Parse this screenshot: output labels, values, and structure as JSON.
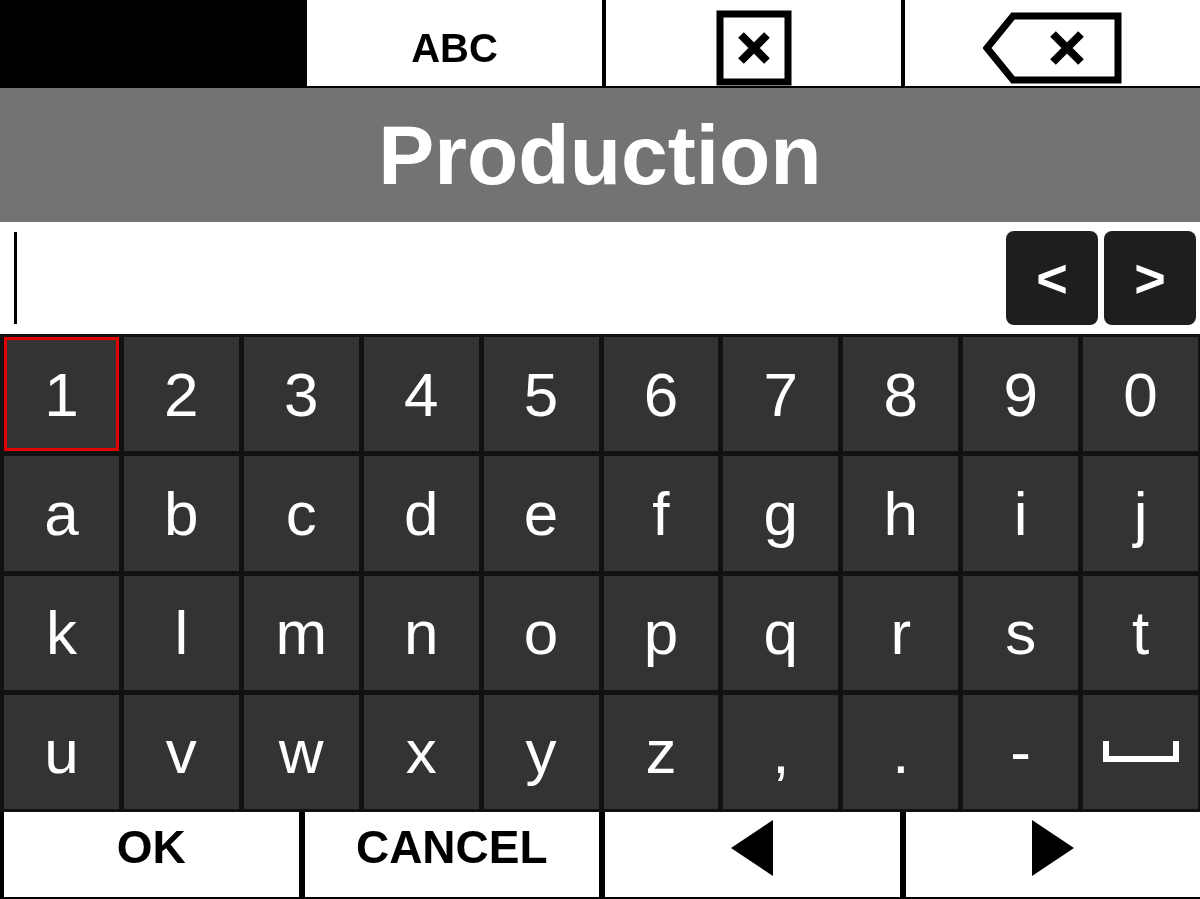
{
  "top_keys": [
    {
      "kind": "text",
      "label": "ABC"
    },
    {
      "kind": "clear"
    },
    {
      "kind": "backspace"
    }
  ],
  "title": "Production",
  "cursor_buttons": [
    "<",
    ">"
  ],
  "keyboard": [
    [
      {
        "kind": "char",
        "label": "1",
        "selected": true
      },
      {
        "kind": "char",
        "label": "2",
        "selected": false
      },
      {
        "kind": "char",
        "label": "3",
        "selected": false
      },
      {
        "kind": "char",
        "label": "4",
        "selected": false
      },
      {
        "kind": "char",
        "label": "5",
        "selected": false
      },
      {
        "kind": "char",
        "label": "6",
        "selected": false
      },
      {
        "kind": "char",
        "label": "7",
        "selected": false
      },
      {
        "kind": "char",
        "label": "8",
        "selected": false
      },
      {
        "kind": "char",
        "label": "9",
        "selected": false
      },
      {
        "kind": "char",
        "label": "0",
        "selected": false
      }
    ],
    [
      {
        "kind": "char",
        "label": "a",
        "selected": false
      },
      {
        "kind": "char",
        "label": "b",
        "selected": false
      },
      {
        "kind": "char",
        "label": "c",
        "selected": false
      },
      {
        "kind": "char",
        "label": "d",
        "selected": false
      },
      {
        "kind": "char",
        "label": "e",
        "selected": false
      },
      {
        "kind": "char",
        "label": "f",
        "selected": false
      },
      {
        "kind": "char",
        "label": "g",
        "selected": false
      },
      {
        "kind": "char",
        "label": "h",
        "selected": false
      },
      {
        "kind": "char",
        "label": "i",
        "selected": false
      },
      {
        "kind": "char",
        "label": "j",
        "selected": false
      }
    ],
    [
      {
        "kind": "char",
        "label": "k",
        "selected": false
      },
      {
        "kind": "char",
        "label": "l",
        "selected": false
      },
      {
        "kind": "char",
        "label": "m",
        "selected": false
      },
      {
        "kind": "char",
        "label": "n",
        "selected": false
      },
      {
        "kind": "char",
        "label": "o",
        "selected": false
      },
      {
        "kind": "char",
        "label": "p",
        "selected": false
      },
      {
        "kind": "char",
        "label": "q",
        "selected": false
      },
      {
        "kind": "char",
        "label": "r",
        "selected": false
      },
      {
        "kind": "char",
        "label": "s",
        "selected": false
      },
      {
        "kind": "char",
        "label": "t",
        "selected": false
      }
    ],
    [
      {
        "kind": "char",
        "label": "u",
        "selected": false
      },
      {
        "kind": "char",
        "label": "v",
        "selected": false
      },
      {
        "kind": "char",
        "label": "w",
        "selected": false
      },
      {
        "kind": "char",
        "label": "x",
        "selected": false
      },
      {
        "kind": "char",
        "label": "y",
        "selected": false
      },
      {
        "kind": "char",
        "label": "z",
        "selected": false
      },
      {
        "kind": "char",
        "label": ",",
        "selected": false
      },
      {
        "kind": "char",
        "label": ".",
        "selected": false
      },
      {
        "kind": "char",
        "label": "-",
        "selected": false
      },
      {
        "kind": "space",
        "selected": false
      }
    ]
  ],
  "bottom_keys": [
    {
      "kind": "text",
      "label": "OK"
    },
    {
      "kind": "text",
      "label": "CANCEL"
    },
    {
      "kind": "left"
    },
    {
      "kind": "right"
    }
  ]
}
